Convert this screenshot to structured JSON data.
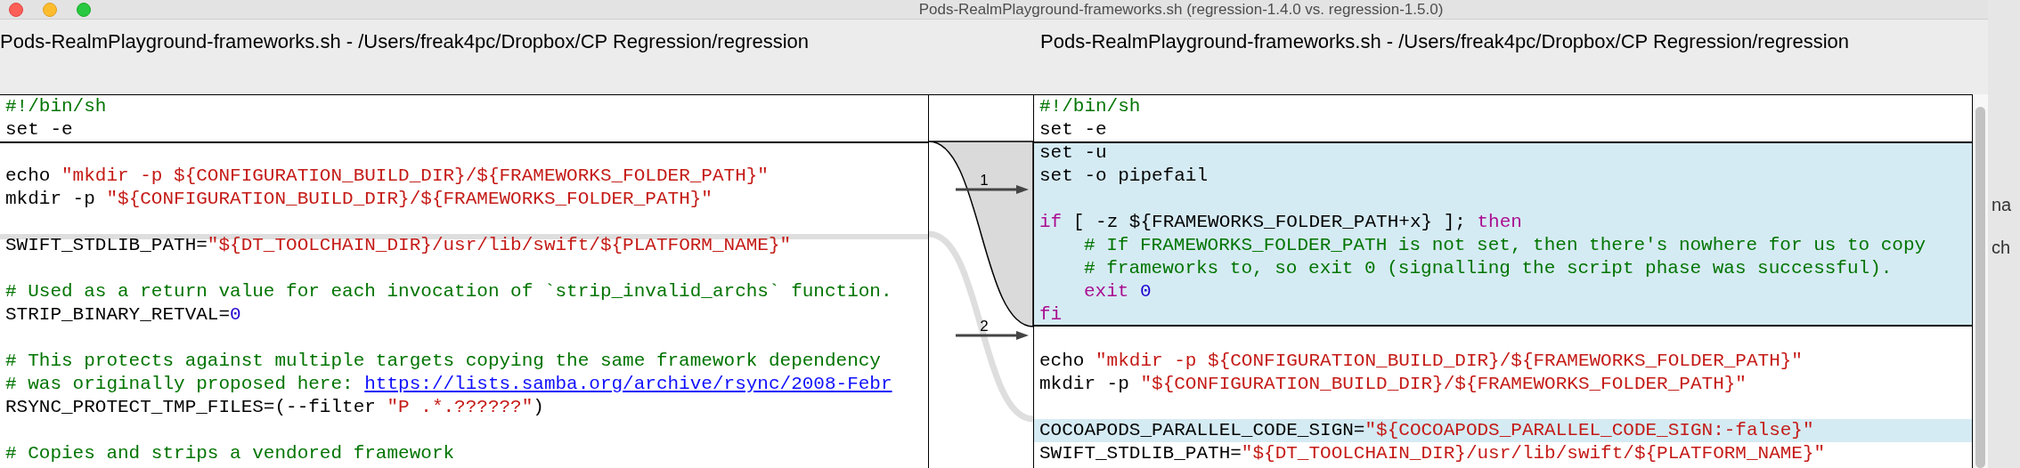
{
  "window": {
    "title": "Pods-RealmPlayground-frameworks.sh (regression-1.4.0 vs. regression-1.5.0)"
  },
  "panes": [
    {
      "path": "Pods-RealmPlayground-frameworks.sh - /Users/freak4pc/Dropbox/CP Regression/regression",
      "lines": [
        {
          "kind": "code",
          "segments": [
            {
              "kind": "comment",
              "text": "#!/bin/sh"
            }
          ]
        },
        {
          "kind": "code",
          "segments": [
            {
              "kind": "plain",
              "text": "set -e"
            }
          ]
        },
        {
          "kind": "blank",
          "anchor": true
        },
        {
          "kind": "code",
          "segments": [
            {
              "kind": "plain",
              "text": "echo "
            },
            {
              "kind": "string",
              "text": "\"mkdir -p ${CONFIGURATION_BUILD_DIR}/${FRAMEWORKS_FOLDER_PATH}\""
            }
          ]
        },
        {
          "kind": "code",
          "segments": [
            {
              "kind": "plain",
              "text": "mkdir -p "
            },
            {
              "kind": "string",
              "text": "\"${CONFIGURATION_BUILD_DIR}/${FRAMEWORKS_FOLDER_PATH}\""
            }
          ]
        },
        {
          "kind": "blank"
        },
        {
          "kind": "code",
          "anchor": true,
          "segments": [
            {
              "kind": "plain",
              "text": "SWIFT_STDLIB_PATH="
            },
            {
              "kind": "string",
              "text": "\"${DT_TOOLCHAIN_DIR}/usr/lib/swift/${PLATFORM_NAME}\""
            }
          ]
        },
        {
          "kind": "blank"
        },
        {
          "kind": "code",
          "segments": [
            {
              "kind": "comment",
              "text": "# Used as a return value for each invocation of `strip_invalid_archs` function."
            }
          ]
        },
        {
          "kind": "code",
          "segments": [
            {
              "kind": "plain",
              "text": "STRIP_BINARY_RETVAL="
            },
            {
              "kind": "number",
              "text": "0"
            }
          ]
        },
        {
          "kind": "blank"
        },
        {
          "kind": "code",
          "segments": [
            {
              "kind": "comment",
              "text": "# This protects against multiple targets copying the same framework dependency"
            }
          ]
        },
        {
          "kind": "code",
          "segments": [
            {
              "kind": "comment",
              "text": "# was originally proposed here: "
            },
            {
              "kind": "link",
              "text": "https://lists.samba.org/archive/rsync/2008-Febr"
            }
          ]
        },
        {
          "kind": "code",
          "segments": [
            {
              "kind": "plain",
              "text": "RSYNC_PROTECT_TMP_FILES=(--filter "
            },
            {
              "kind": "string",
              "text": "\"P .*.??????\""
            },
            {
              "kind": "plain",
              "text": ")"
            }
          ]
        },
        {
          "kind": "blank"
        },
        {
          "kind": "code",
          "segments": [
            {
              "kind": "comment",
              "text": "# Copies and strips a vendored framework"
            }
          ]
        }
      ]
    },
    {
      "path": "Pods-RealmPlayground-frameworks.sh - /Users/freak4pc/Dropbox/CP Regression/regression",
      "lines": [
        {
          "kind": "code",
          "segments": [
            {
              "kind": "comment",
              "text": "#!/bin/sh"
            }
          ]
        },
        {
          "kind": "code",
          "segments": [
            {
              "kind": "plain",
              "text": "set -e"
            }
          ]
        },
        {
          "kind": "code",
          "changed": true,
          "segments": [
            {
              "kind": "plain",
              "text": "set -u"
            }
          ]
        },
        {
          "kind": "code",
          "changed": true,
          "segments": [
            {
              "kind": "plain",
              "text": "set -o pipefail"
            }
          ]
        },
        {
          "kind": "blank",
          "changed": true
        },
        {
          "kind": "code",
          "changed": true,
          "segments": [
            {
              "kind": "keyword",
              "text": "if"
            },
            {
              "kind": "plain",
              "text": " [ -z ${FRAMEWORKS_FOLDER_PATH+x} ]; "
            },
            {
              "kind": "keyword",
              "text": "then"
            }
          ]
        },
        {
          "kind": "code",
          "changed": true,
          "indented": true,
          "segments": [
            {
              "kind": "comment",
              "text": "# If FRAMEWORKS_FOLDER_PATH is not set, then there's nowhere for us to copy"
            }
          ]
        },
        {
          "kind": "code",
          "changed": true,
          "indented": true,
          "segments": [
            {
              "kind": "comment",
              "text": "# frameworks to, so exit 0 (signalling the script phase was successful)."
            }
          ]
        },
        {
          "kind": "code",
          "changed": true,
          "indented": true,
          "segments": [
            {
              "kind": "keyword",
              "text": "exit "
            },
            {
              "kind": "number",
              "text": "0"
            }
          ]
        },
        {
          "kind": "code",
          "changed": true,
          "segments": [
            {
              "kind": "keyword",
              "text": "fi"
            }
          ]
        },
        {
          "kind": "blank"
        },
        {
          "kind": "code",
          "segments": [
            {
              "kind": "plain",
              "text": "echo "
            },
            {
              "kind": "string",
              "text": "\"mkdir -p ${CONFIGURATION_BUILD_DIR}/${FRAMEWORKS_FOLDER_PATH}\""
            }
          ]
        },
        {
          "kind": "code",
          "segments": [
            {
              "kind": "plain",
              "text": "mkdir -p "
            },
            {
              "kind": "string",
              "text": "\"${CONFIGURATION_BUILD_DIR}/${FRAMEWORKS_FOLDER_PATH}\""
            }
          ]
        },
        {
          "kind": "blank"
        },
        {
          "kind": "code",
          "changed": true,
          "segments": [
            {
              "kind": "plain",
              "text": "COCOAPODS_PARALLEL_CODE_SIGN="
            },
            {
              "kind": "string",
              "text": "\"${COCOAPODS_PARALLEL_CODE_SIGN:-false}\""
            }
          ]
        },
        {
          "kind": "code",
          "segments": [
            {
              "kind": "plain",
              "text": "SWIFT_STDLIB_PATH="
            },
            {
              "kind": "string",
              "text": "\"${DT_TOOLCHAIN_DIR}/usr/lib/swift/${PLATFORM_NAME}\""
            }
          ]
        }
      ]
    }
  ],
  "diffs": [
    {
      "label": "1",
      "selected": true
    },
    {
      "label": "2",
      "selected": false
    }
  ],
  "background_window": {
    "fragments": [
      "na",
      "ch"
    ]
  }
}
